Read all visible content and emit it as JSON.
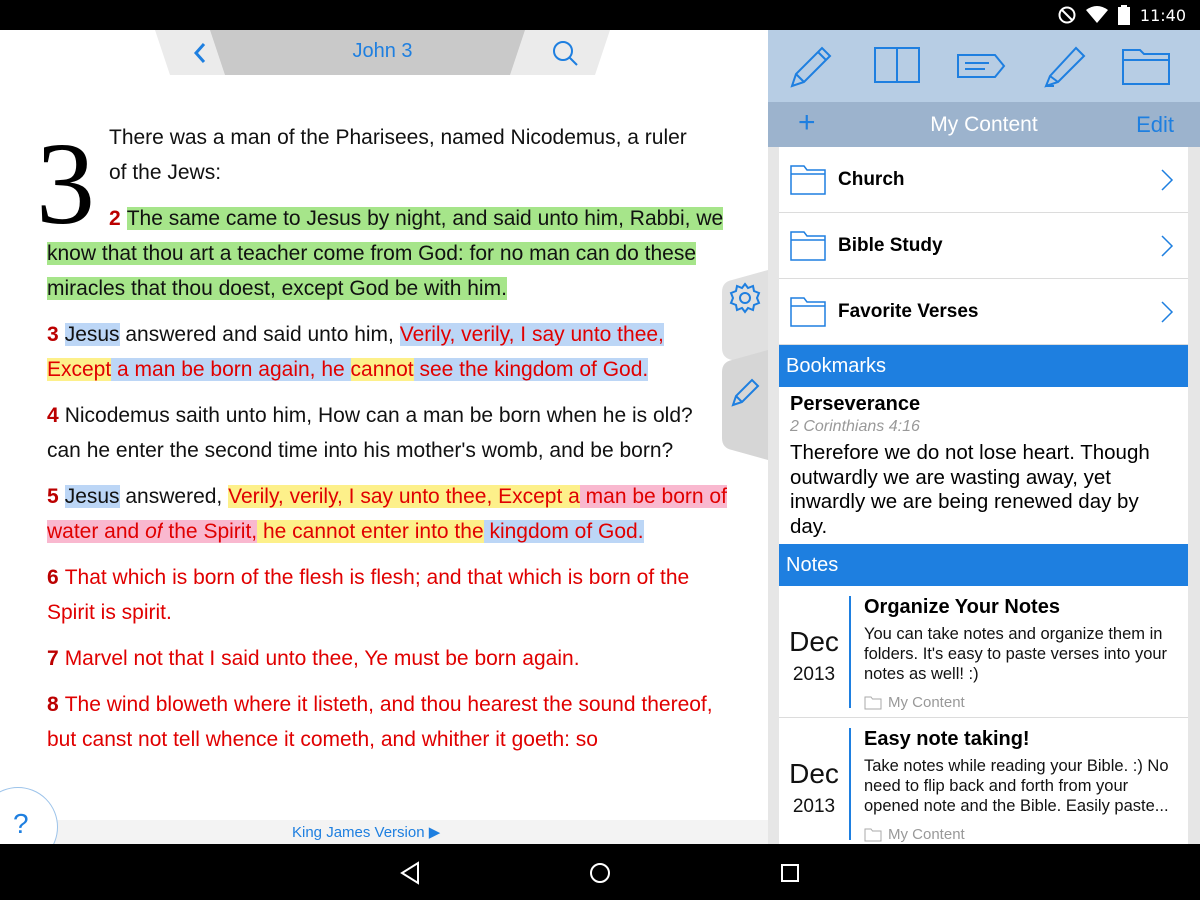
{
  "status_bar": {
    "time": "11:40"
  },
  "reader": {
    "chapter_title": "John 3",
    "chapter_number": "3",
    "version_label": "King James Version ▶",
    "help_label": "?",
    "verse1": "There was a man of the Pharisees, named Nicodemus, a ruler of the Jews:",
    "v2_num": "2",
    "v2_text": "The same came to Jesus by night, and said unto him, Rabbi, we know that thou art a teacher come from God: for no man can do these miracles that thou doest, except God be with him.",
    "v3_num": "3",
    "v3_a": "Jesus",
    "v3_b": " answered and said unto him, ",
    "v3_c": "Verily, verily, I say unto thee,",
    "v3_d": "Except",
    "v3_e": " a man be born again, he ",
    "v3_f": "cannot",
    "v3_g": " see the kingdom of God.",
    "v4_num": "4",
    "v4_text": "Nicodemus saith unto him, How can a man be born when he is old? can he enter the second time into his mother's womb, and be born?",
    "v5_num": "5",
    "v5_a": "Jesus",
    "v5_b": " answered, ",
    "v5_c": "Verily, verily, I say unto thee, Except a",
    "v5_d": " man be born of water and ",
    "v5_e": "of",
    "v5_f": " the Spirit,",
    "v5_g": " he cannot enter into the",
    "v5_h": " kingdom of God.",
    "v6_num": "6",
    "v6_text": "That which is born of the flesh is flesh; and that which is born of the Spirit is spirit.",
    "v7_num": "7",
    "v7_text": "Marvel not that I said unto thee, Ye must be born again.",
    "v8_num": "8",
    "v8_text": "The wind bloweth where it listeth, and thou hearest the sound thereof, but canst not tell whence it cometh, and whither it goeth: so"
  },
  "panel": {
    "title": "My Content",
    "add_label": "+",
    "edit_label": "Edit",
    "folders": [
      {
        "label": "Church"
      },
      {
        "label": "Bible Study"
      },
      {
        "label": "Favorite Verses"
      }
    ],
    "bookmarks_header": "Bookmarks",
    "bookmark": {
      "title": "Perseverance",
      "reference": "2 Corinthians 4:16",
      "text": "Therefore we do not lose heart. Though outwardly we are wasting away, yet inwardly we are being renewed day by day."
    },
    "notes_header": "Notes",
    "notes": [
      {
        "month": "Dec",
        "year": "2013",
        "title": "Organize Your Notes",
        "body": "You can take notes and organize them in folders. It's easy to paste verses into your notes as well! :)",
        "folder": "My Content"
      },
      {
        "month": "Dec",
        "year": "2013",
        "title": "Easy note taking!",
        "body": "Take notes while reading your Bible. :) No need to flip back and forth from your opened note and the Bible. Easily paste...",
        "folder": "My Content"
      }
    ]
  },
  "colors": {
    "accent": "#1e7fe0",
    "highlight_green": "#a6e58a",
    "highlight_blue": "#bcd6f6",
    "highlight_yellow": "#fdf08a",
    "highlight_pink": "#f9b8cf",
    "red_letter": "#e00000"
  },
  "icons": [
    "do-not-disturb-icon",
    "wifi-icon",
    "battery-icon",
    "back-chevron-icon",
    "search-icon",
    "gear-icon",
    "pencil-icon",
    "book-icon",
    "tag-icon",
    "highlighter-icon",
    "folder-icon",
    "chevron-right-icon",
    "nav-back-icon",
    "nav-home-icon",
    "nav-recents-icon"
  ]
}
